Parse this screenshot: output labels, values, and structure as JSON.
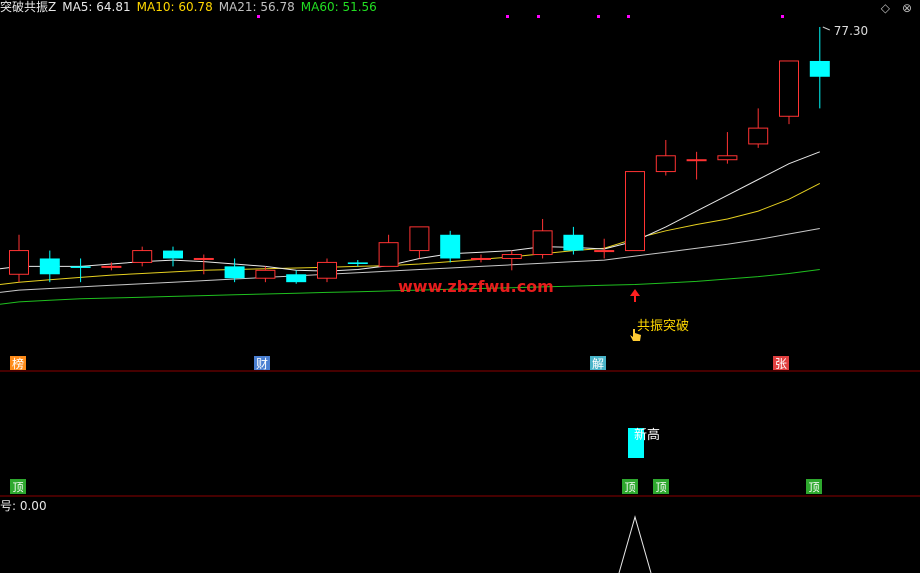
{
  "indicator_name": "突破共振Z",
  "ma_readout": [
    {
      "label": "MA5: 64.81",
      "color": "#e8e8e8"
    },
    {
      "label": "MA10: 60.78",
      "color": "#ffd700"
    },
    {
      "label": "MA21: 56.78",
      "color": "#c0c0c0"
    },
    {
      "label": "MA60: 51.56",
      "color": "#22dd22"
    }
  ],
  "price_high_label": "77.30",
  "signal_text": "共振突破",
  "watermark": "www.zbzfwu.com",
  "event_tags": [
    {
      "text": "榜",
      "bg": "#ff8c1a"
    },
    {
      "text": "财",
      "bg": "#4a7fd1"
    },
    {
      "text": "解",
      "bg": "#49b4c9"
    },
    {
      "text": "张",
      "bg": "#e04040"
    }
  ],
  "sub_label": "新高",
  "tag_small": "顶",
  "bottom_readout": "号: 0.00",
  "controls": {
    "settings": "◇",
    "close": "⊗"
  },
  "colors": {
    "up": "#ff3333",
    "down": "#00ffff",
    "separator": "#8b0000",
    "ma60": "#1fbf1f",
    "magenta": "#ff00ff"
  },
  "chart_data": {
    "type": "candlestick",
    "last_high": 77.3,
    "candles": [
      {
        "o": 46,
        "c": 49,
        "h": 51,
        "l": 45
      },
      {
        "o": 48,
        "c": 46,
        "h": 49,
        "l": 45
      },
      {
        "o": 47,
        "c": 46.8,
        "h": 48,
        "l": 45
      },
      {
        "o": 47,
        "c": 47,
        "h": 47.5,
        "l": 46.5
      },
      {
        "o": 47.5,
        "c": 49,
        "h": 49.5,
        "l": 47
      },
      {
        "o": 49,
        "c": 48,
        "h": 49.5,
        "l": 47
      },
      {
        "o": 48,
        "c": 48,
        "h": 48.5,
        "l": 46
      },
      {
        "o": 47,
        "c": 45.5,
        "h": 48,
        "l": 45
      },
      {
        "o": 45.5,
        "c": 46.5,
        "h": 47,
        "l": 45
      },
      {
        "o": 46,
        "c": 45,
        "h": 46.5,
        "l": 44.8
      },
      {
        "o": 45.5,
        "c": 47.5,
        "h": 48,
        "l": 45
      },
      {
        "o": 47.5,
        "c": 47.3,
        "h": 47.8,
        "l": 47
      },
      {
        "o": 47,
        "c": 50,
        "h": 51,
        "l": 47
      },
      {
        "o": 49,
        "c": 52,
        "h": 52,
        "l": 48
      },
      {
        "o": 51,
        "c": 48,
        "h": 51.5,
        "l": 47.5
      },
      {
        "o": 48,
        "c": 48,
        "h": 48.5,
        "l": 47.5
      },
      {
        "o": 48,
        "c": 48.5,
        "h": 49,
        "l": 46.5
      },
      {
        "o": 48.5,
        "c": 51.5,
        "h": 53,
        "l": 48
      },
      {
        "o": 51,
        "c": 49,
        "h": 52,
        "l": 48.5
      },
      {
        "o": 49,
        "c": 49,
        "h": 50.5,
        "l": 48
      },
      {
        "o": 49,
        "c": 59,
        "h": 59,
        "l": 49
      },
      {
        "o": 59,
        "c": 61,
        "h": 63,
        "l": 58.5
      },
      {
        "o": 60.5,
        "c": 60.5,
        "h": 61.5,
        "l": 58
      },
      {
        "o": 60.5,
        "c": 61,
        "h": 64,
        "l": 60
      },
      {
        "o": 62.5,
        "c": 64.5,
        "h": 67,
        "l": 62
      },
      {
        "o": 66,
        "c": 73,
        "h": 73,
        "l": 65
      },
      {
        "o": 73,
        "c": 71,
        "h": 77.3,
        "l": 67
      }
    ],
    "ma5": [
      47,
      47,
      47,
      47.3,
      47.6,
      47.8,
      47.6,
      47.3,
      47,
      46.5,
      46.4,
      46.6,
      47.1,
      48,
      48.6,
      48.8,
      49,
      49.5,
      49.4,
      49.2,
      50.2,
      52,
      54,
      56,
      58,
      60,
      61.5
    ],
    "ma10": [
      45,
      45.3,
      45.6,
      45.9,
      46.1,
      46.3,
      46.5,
      46.6,
      46.7,
      46.8,
      46.9,
      47,
      47.1,
      47.3,
      47.6,
      47.9,
      48.2,
      48.6,
      49,
      49.3,
      50.5,
      51.5,
      52.3,
      53,
      54,
      55.5,
      57.5
    ],
    "ma21": [
      44,
      44.2,
      44.4,
      44.6,
      44.8,
      45,
      45.2,
      45.4,
      45.6,
      45.8,
      46,
      46.2,
      46.4,
      46.6,
      46.8,
      47,
      47.2,
      47.4,
      47.6,
      47.8,
      48.3,
      48.8,
      49.3,
      49.8,
      50.4,
      51.1,
      51.8
    ],
    "ma60": [
      42.5,
      42.7,
      42.9,
      43,
      43.1,
      43.2,
      43.3,
      43.4,
      43.5,
      43.6,
      43.7,
      43.8,
      43.9,
      44,
      44.1,
      44.2,
      44.3,
      44.4,
      44.5,
      44.6,
      44.7,
      44.9,
      45.1,
      45.4,
      45.7,
      46.1,
      46.6
    ],
    "new_high_bar_index": 20,
    "signal_peak_index": 20,
    "tag_indices": [
      0,
      20,
      21,
      26
    ]
  }
}
